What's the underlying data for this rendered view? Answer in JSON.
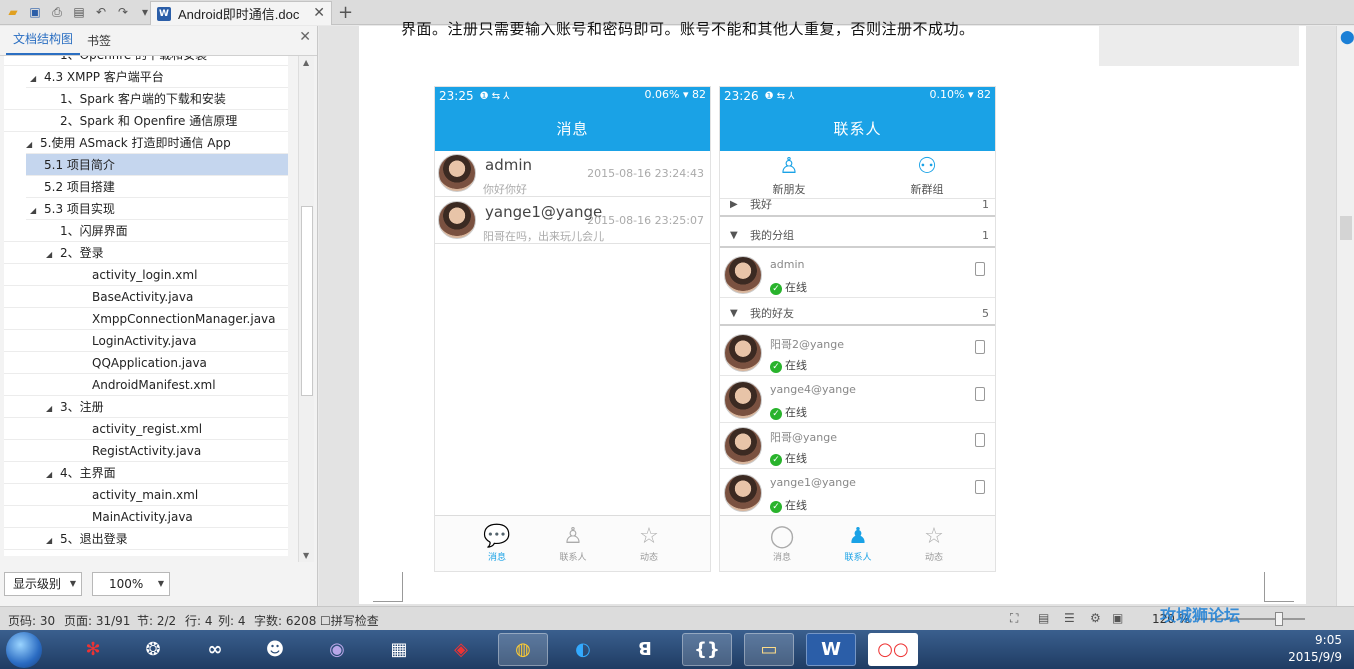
{
  "window": {
    "doc_tab_title": "Android即时通信.doc",
    "quick_access_icons": [
      "folder-icon",
      "save-icon",
      "print-icon",
      "print-preview-icon",
      "undo-icon",
      "redo-icon",
      "dropdown-icon"
    ]
  },
  "nav": {
    "tab_outline": "文档结构图",
    "tab_bookmarks": "书签",
    "items": [
      {
        "label": "1、Openfire 的下载和安装",
        "level": 2,
        "arrow": ""
      },
      {
        "label": "4.3 XMPP 客户端平台",
        "level": 1,
        "arrow": "◢"
      },
      {
        "label": "1、Spark 客户端的下载和安装",
        "level": 2,
        "arrow": ""
      },
      {
        "label": "2、Spark 和 Openfire 通信原理",
        "level": 2,
        "arrow": ""
      },
      {
        "label": "5.使用 ASmack 打造即时通信 App",
        "level": 0,
        "arrow": "◢"
      },
      {
        "label": "5.1 项目简介",
        "level": 1,
        "arrow": "",
        "selected": true
      },
      {
        "label": "5.2 项目搭建",
        "level": 1,
        "arrow": ""
      },
      {
        "label": "5.3 项目实现",
        "level": 1,
        "arrow": "◢"
      },
      {
        "label": "1、闪屏界面",
        "level": 2,
        "arrow": ""
      },
      {
        "label": "2、登录",
        "level": 2,
        "arrow": "◢"
      },
      {
        "label": "activity_login.xml",
        "level": 3,
        "arrow": ""
      },
      {
        "label": "BaseActivity.java",
        "level": 3,
        "arrow": ""
      },
      {
        "label": "XmppConnectionManager.java",
        "level": 3,
        "arrow": ""
      },
      {
        "label": "LoginActivity.java",
        "level": 3,
        "arrow": ""
      },
      {
        "label": "QQApplication.java",
        "level": 3,
        "arrow": ""
      },
      {
        "label": "AndroidManifest.xml",
        "level": 3,
        "arrow": ""
      },
      {
        "label": "3、注册",
        "level": 2,
        "arrow": "◢"
      },
      {
        "label": "activity_regist.xml",
        "level": 3,
        "arrow": ""
      },
      {
        "label": "RegistActivity.java",
        "level": 3,
        "arrow": ""
      },
      {
        "label": "4、主界面",
        "level": 2,
        "arrow": "◢"
      },
      {
        "label": "activity_main.xml",
        "level": 3,
        "arrow": ""
      },
      {
        "label": "MainActivity.java",
        "level": 3,
        "arrow": ""
      },
      {
        "label": "5、退出登录",
        "level": 2,
        "arrow": "◢"
      }
    ],
    "show_level": "显示级别",
    "zoom": "100%"
  },
  "doc": {
    "text_line": "界面。注册只需要输入账号和密码即可。账号不能和其他人重复，否则注册不成功。"
  },
  "phone1": {
    "time": "23:25",
    "status_right": "0.06% ▾ 82",
    "title": "消息",
    "conversations": [
      {
        "name": "admin",
        "msg": "你好你好",
        "time": "2015-08-16 23:24:43"
      },
      {
        "name": "yange1@yange",
        "msg": "阳哥在吗，出来玩儿会儿",
        "time": "2015-08-16 23:25:07"
      }
    ],
    "nav": [
      "消息",
      "联系人",
      "动态"
    ]
  },
  "phone2": {
    "time": "23:26",
    "status_right": "0.10% ▾ 82",
    "title": "联系人",
    "new_friend": "新朋友",
    "new_group": "新群组",
    "groups": [
      {
        "name": "我好",
        "count": "1",
        "arrow": "▶"
      },
      {
        "name": "我的分组",
        "count": "1",
        "arrow": "▼"
      },
      {
        "name": "我的好友",
        "count": "5",
        "arrow": "▼"
      }
    ],
    "contacts": [
      {
        "name": "admin",
        "status": "在线"
      },
      {
        "name": "阳哥2@yange",
        "status": "在线"
      },
      {
        "name": "yange4@yange",
        "status": "在线"
      },
      {
        "name": "阳哥@yange",
        "status": "在线"
      },
      {
        "name": "yange1@yange",
        "status": "在线"
      }
    ],
    "nav": [
      "消息",
      "联系人",
      "动态"
    ]
  },
  "statusbar": {
    "page_code": "页码: 30",
    "page": "页面: 31/91",
    "section": "节: 2/2",
    "row": "行: 4",
    "col": "列: 4",
    "word_count": "字数: 6208",
    "spell_check": "拼写检查",
    "zoom": "120 %"
  },
  "taskbar": {
    "time": "9:05",
    "date": "2015/9/9",
    "watermark": "攻城狮论坛"
  },
  "colors": {
    "accent": "#1aa2e6",
    "online": "#29b32c",
    "selection": "#c5d6ee"
  }
}
